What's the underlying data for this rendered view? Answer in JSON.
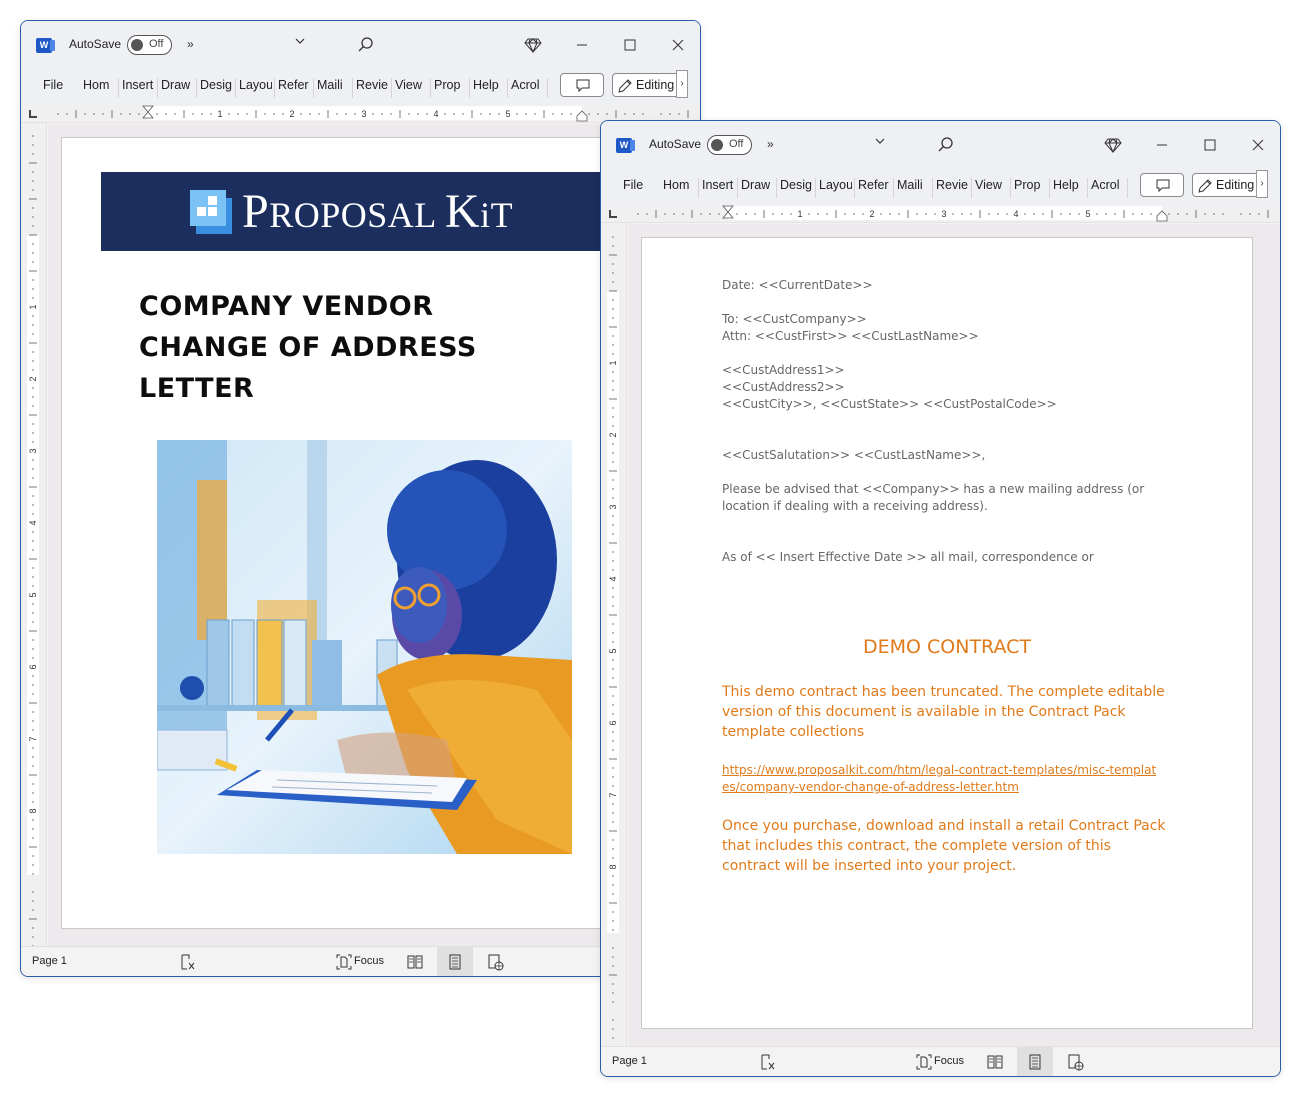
{
  "windows": [
    {
      "id": "cover",
      "titlebar": {
        "app_icon": "word-icon",
        "app_icon_letter": "W",
        "autosave_label": "AutoSave",
        "autosave_state": "Off",
        "more_commands": "»",
        "dropdown": "⌄",
        "search_icon": "search-icon",
        "premium_icon": "diamond-icon",
        "minimize": "minimize-icon",
        "maximize": "maximize-icon",
        "close": "close-icon"
      },
      "ribbon": {
        "tabs": [
          "File",
          "Home",
          "Insert",
          "Draw",
          "Design",
          "Layout",
          "References",
          "Mailings",
          "Review",
          "View",
          "Properties",
          "Help",
          "Acrobat"
        ],
        "tabs_visible": [
          "File",
          "Hom",
          "Insert",
          "Draw",
          "Desig",
          "Layou",
          "Refer",
          "Maili",
          "Revie",
          "View",
          "Prop",
          "Help",
          "Acrol"
        ],
        "comments_icon": "comment-icon",
        "editing_label": "Editing",
        "expand_chevron": "›"
      },
      "ruler": {
        "horizontal_labels": [
          "1",
          "2",
          "3",
          "4",
          "5"
        ],
        "vertical_labels": [
          "1",
          "2",
          "3",
          "4",
          "5",
          "6",
          "7",
          "8"
        ]
      },
      "document": {
        "banner_brand": "PROPOSAL KIT",
        "banner_brand_parts": [
          "P",
          "ROPOSAL ",
          "K",
          "i",
          "T"
        ],
        "title_lines": [
          "COMPANY VENDOR",
          "CHANGE OF ADDRESS",
          "LETTER"
        ],
        "illustration": "Watercolor illustration of a woman with glasses in a yellow jacket writing on a clipboard at a desk"
      },
      "statusbar": {
        "page_label": "Page 1",
        "accessibility_icon": "accessibility-check-icon",
        "focus_label": "Focus",
        "read_mode_icon": "read-mode-icon",
        "print_layout_icon": "print-layout-icon",
        "web_layout_icon": "web-layout-icon"
      }
    },
    {
      "id": "letter",
      "titlebar": {
        "app_icon": "word-icon",
        "app_icon_letter": "W",
        "autosave_label": "AutoSave",
        "autosave_state": "Off",
        "more_commands": "»",
        "dropdown": "⌄",
        "search_icon": "search-icon",
        "premium_icon": "diamond-icon",
        "minimize": "minimize-icon",
        "maximize": "maximize-icon",
        "close": "close-icon"
      },
      "ribbon": {
        "tabs_visible": [
          "File",
          "Hom",
          "Insert",
          "Draw",
          "Desig",
          "Layou",
          "Refer",
          "Maili",
          "Revie",
          "View",
          "Prop",
          "Help",
          "Acrol"
        ],
        "comments_icon": "comment-icon",
        "editing_label": "Editing",
        "expand_chevron": "›"
      },
      "ruler": {
        "horizontal_labels": [
          "1",
          "2",
          "3",
          "4",
          "5"
        ],
        "vertical_labels": [
          "1",
          "2",
          "3",
          "4",
          "5",
          "6",
          "7",
          "8"
        ]
      },
      "document": {
        "date_line": "Date: <<CurrentDate>>",
        "to_line": "To: <<CustCompany>>",
        "attn_line": "Attn: <<CustFirst>> <<CustLastName>>",
        "address1": "<<CustAddress1>>",
        "address2": "<<CustAddress2>>",
        "city_line": "<<CustCity>>, <<CustState>> <<CustPostalCode>>",
        "salutation": "<<CustSalutation>> <<CustLastName>>,",
        "paragraph1": "Please be advised that <<Company>> has a new mailing address (or location if dealing with a receiving address).",
        "paragraph2": "As of << Insert Effective Date >> all mail, correspondence or",
        "demo_title": "DEMO CONTRACT",
        "demo_notice": "This demo contract has been truncated. The complete editable version of this document is available in the Contract Pack template collections",
        "demo_link": "https://www.proposalkit.com/htm/legal-contract-templates/misc-templates/company-vendor-change-of-address-letter.htm",
        "demo_purchase": "Once you purchase, download and install a retail Contract Pack that includes this contract, the complete version of this contract will be inserted into your project."
      },
      "statusbar": {
        "page_label": "Page 1",
        "accessibility_icon": "accessibility-check-icon",
        "focus_label": "Focus",
        "read_mode_icon": "read-mode-icon",
        "print_layout_icon": "print-layout-icon",
        "web_layout_icon": "web-layout-icon"
      }
    }
  ],
  "colors": {
    "window_border": "#2a5ca8",
    "banner_navy": "#1b2e5e",
    "demo_orange": "#e07a1a",
    "letter_gray": "#666666",
    "word_blue": "#1e58c7"
  }
}
